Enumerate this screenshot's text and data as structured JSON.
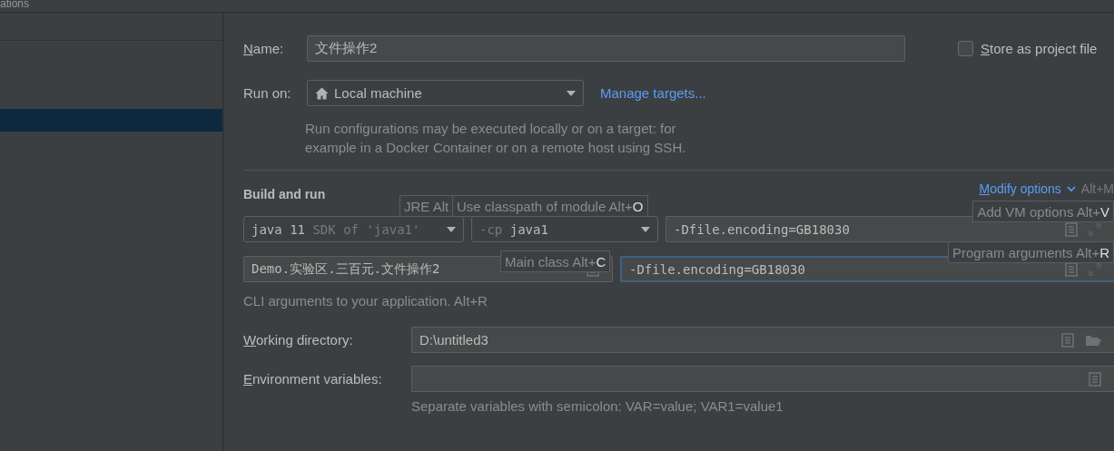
{
  "window": {
    "title": "ations"
  },
  "sidebar": {
    "items": [
      {
        "selected": false
      },
      {
        "selected": false
      },
      {
        "selected": false
      },
      {
        "selected": true
      }
    ]
  },
  "name": {
    "mnemonic": "N",
    "label": "ame:",
    "value": "文件操作2"
  },
  "store_as_project_file": {
    "mnemonic": "S",
    "label": "tore as project file",
    "checked": false
  },
  "run_on": {
    "label": "Run on:",
    "value": "Local machine",
    "link": "Manage targets..."
  },
  "description": [
    "Run configurations may be executed locally or on a target: for",
    "example in a Docker Container or on a remote host using SSH."
  ],
  "build_and_run": {
    "title": "Build and run",
    "modify_options": {
      "mnemonic": "M",
      "label": "odify options",
      "shortcut": "Alt+M"
    },
    "jre": {
      "name": "java 11",
      "detail": "SDK of 'java1'"
    },
    "classpath": {
      "prefix": "-cp",
      "value": "java1"
    },
    "vm_options": {
      "value": "-Dfile.encoding=GB18030"
    },
    "main_class": {
      "value": "Demo.实验区.三百元.文件操作2"
    },
    "program_arguments": {
      "value": "-Dfile.encoding=GB18030",
      "focused": true
    },
    "hint": "CLI arguments to your application. Alt+R"
  },
  "working_directory": {
    "mnemonic": "W",
    "label": "orking directory:",
    "value": "D:\\untitled3"
  },
  "environment_variables": {
    "mnemonic": "E",
    "label": "nvironment variables:",
    "hint": "Separate variables with semicolon: VAR=value; VAR1=value1"
  },
  "tooltips": [
    {
      "label": "JRE Alt"
    },
    {
      "label": "Use classpath of module Alt+",
      "key": "O"
    },
    {
      "label": "Add VM options Alt+",
      "key": "V"
    },
    {
      "label": "Main class Alt+",
      "key": "C"
    },
    {
      "label": "Program arguments Alt+",
      "key": "R"
    }
  ]
}
